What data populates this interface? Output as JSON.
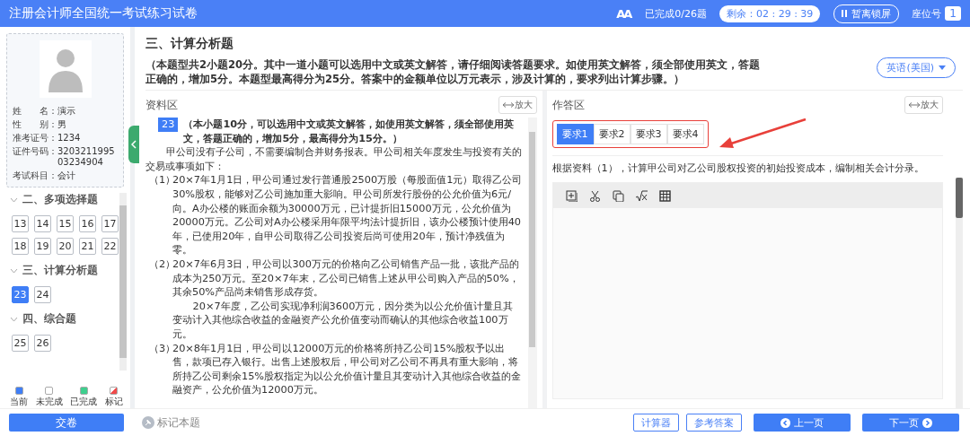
{
  "header": {
    "title": "注册会计师全国统一考试练习试卷",
    "font_size_glyph": "AA",
    "progress": "已完成0/26题",
    "timer": "剩余：02 : 29 : 39",
    "lock_button": "暂离锁屏",
    "seat_label": "座位号",
    "seat_number": "1"
  },
  "candidate": {
    "fields": [
      {
        "label": "姓　　名：",
        "value": "演示"
      },
      {
        "label": "性　　别：",
        "value": "男"
      },
      {
        "label": "准考证号：",
        "value": "1234"
      },
      {
        "label": "证件号码：",
        "value": "320321199503234904"
      },
      {
        "label": "考试科目：",
        "value": "会计"
      }
    ]
  },
  "nav_sections": [
    {
      "title": "二、多项选择题",
      "expanded": true,
      "items": [
        {
          "number": "13",
          "selected": false
        },
        {
          "number": "14",
          "selected": false
        },
        {
          "number": "15",
          "selected": false
        },
        {
          "number": "16",
          "selected": false
        },
        {
          "number": "17",
          "selected": false
        },
        {
          "number": "18",
          "selected": false
        },
        {
          "number": "19",
          "selected": false
        },
        {
          "number": "20",
          "selected": false
        },
        {
          "number": "21",
          "selected": false
        },
        {
          "number": "22",
          "selected": false
        }
      ]
    },
    {
      "title": "三、计算分析题",
      "expanded": true,
      "items": [
        {
          "number": "23",
          "selected": true
        },
        {
          "number": "24",
          "selected": false
        }
      ]
    },
    {
      "title": "四、综合题",
      "expanded": true,
      "items": [
        {
          "number": "25",
          "selected": false
        },
        {
          "number": "26",
          "selected": false
        }
      ]
    }
  ],
  "legend": [
    {
      "label": "当前",
      "kind": "fill",
      "color": "#3f7ef6"
    },
    {
      "label": "未完成",
      "kind": "fill",
      "color": "#ffffff"
    },
    {
      "label": "已完成",
      "kind": "fill",
      "color": "#3ecf8e"
    },
    {
      "label": "标记",
      "kind": "corner",
      "color": "#f04b4b"
    }
  ],
  "section": {
    "title": "三、计算分析题",
    "instructions": "（本题型共2小题20分。其中一道小题可以选用中文或英文解答，请仔细阅读答题要求。如使用英文解答，须全部使用英文，答题正确的，增加5分。本题型最高得分为25分。答案中的金额单位以万元表示，涉及计算的，要求列出计算步骤。）",
    "language": "英语(美国)"
  },
  "material": {
    "title": "资料区",
    "expand": "放大",
    "question_number": "23",
    "note": "（本小题10分，可以选用中文或英文解答，如使用英文解答，须全部使用英文，答题正确的，增加5分，最高得分为15分。）",
    "paragraphs": [
      {
        "kind": "intro",
        "text": "甲公司没有子公司，不需要编制合并财务报表。甲公司相关年度发生与投资有关的交易或事项如下："
      },
      {
        "kind": "item",
        "label": "（1）",
        "text": "20×7年1月1日，甲公司通过发行普通股2500万股（每股面值1元）取得乙公司30%股权，能够对乙公司施加重大影响。甲公司所发行股份的公允价值为6元/"
      },
      {
        "kind": "fragment",
        "text": "向。A办公楼的账面余额为30000万元，已计提折旧15000万元，公允价值为20000万元。乙公司对A办公楼采用年限平均法计提折旧，该办公楼预计使用40年，已使用20年，自甲公司取得乙公司投资后尚可使用20年，预计净残值为零。"
      },
      {
        "kind": "item",
        "label": "（2）",
        "text": "20×7年6月3日，甲公司以300万元的价格向乙公司销售产品一批，该批产品的成本为250万元。至20×7年末，乙公司已销售上述从甲公司购入产品的50%，其余50%产品尚未销售形成存货。"
      },
      {
        "kind": "indent",
        "text": "20×7年度，乙公司实现净利润3600万元，因分类为以公允价值计量且其变动计入其他综合收益的金融资产公允价值变动而确认的其他综合收益100万元。"
      },
      {
        "kind": "item",
        "label": "（3）",
        "text": "20×8年1月1日，甲公司以12000万元的价格将所持乙公司15%股权予以出售，款项已存入银行。出售上述股权后，甲公司对乙公司不再具有重大影响，将所持乙公司剩余15%股权指定为以公允价值计量且其变动计入其他综合收益的金融资产，公允价值为12000万元。"
      }
    ]
  },
  "answer": {
    "title": "作答区",
    "expand": "放大",
    "tabs": [
      {
        "label": "要求1",
        "selected": true
      },
      {
        "label": "要求2",
        "selected": false
      },
      {
        "label": "要求3",
        "selected": false
      },
      {
        "label": "要求4",
        "selected": false
      }
    ],
    "prompt": "根据资料（1），计算甲公司对乙公司股权投资的初始投资成本，编制相关会计分录。"
  },
  "footer": {
    "submit": "交卷",
    "mark": "标记本题",
    "buttons": [
      {
        "label": "计算器",
        "kind": "outline"
      },
      {
        "label": "参考答案",
        "kind": "outline"
      },
      {
        "label": "上一页",
        "kind": "prev"
      },
      {
        "label": "下一页",
        "kind": "next"
      }
    ]
  }
}
